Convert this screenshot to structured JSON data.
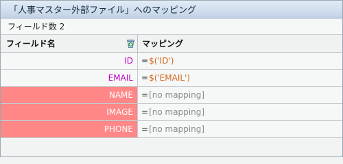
{
  "window": {
    "title": "「人事マスター外部ファイル」へのマッピング"
  },
  "summary": {
    "field_count_label": "フィールド数 2"
  },
  "columns": {
    "field": "フィールド名",
    "mapping": "マッピング"
  },
  "rows": [
    {
      "field": "ID",
      "eq": "=",
      "mapping": "$('ID')",
      "status": "mapped"
    },
    {
      "field": "EMAIL",
      "eq": "=",
      "mapping": "$('EMAIL')",
      "status": "mapped"
    },
    {
      "field": "NAME",
      "eq": "=",
      "mapping": "[no mapping]",
      "status": "unmapped"
    },
    {
      "field": "IMAGE",
      "eq": "=",
      "mapping": "[no mapping]",
      "status": "unmapped"
    },
    {
      "field": "PHONE",
      "eq": "=",
      "mapping": "[no mapping]",
      "status": "unmapped"
    }
  ],
  "colors": {
    "mapped_field": "#c000c0",
    "mapped_value": "#d2691e",
    "unmapped_highlight": "#ff8787"
  },
  "icons": {
    "header_action": "recycle-bin-icon"
  }
}
